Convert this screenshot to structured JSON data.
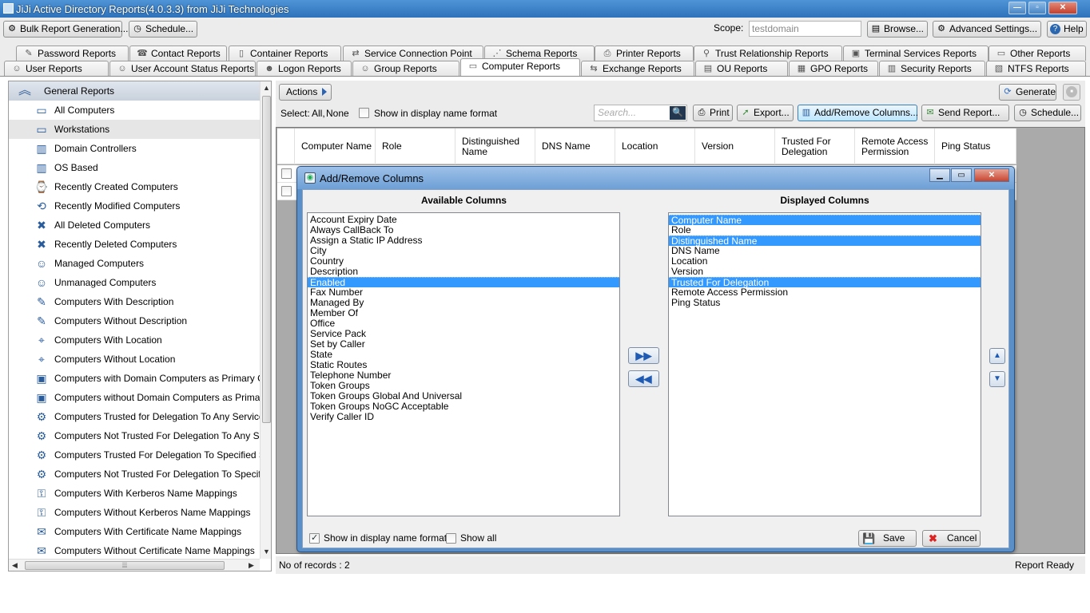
{
  "app": {
    "title": "JiJi Active Directory Reports(4.0.3.3) from JiJi Technologies"
  },
  "toolbar": {
    "bulk_label": "Bulk Report Generation...",
    "schedule_label": "Schedule...",
    "scope_label": "Scope:",
    "scope_value": "testdomain",
    "browse_label": "Browse...",
    "advanced_label": "Advanced  Settings...",
    "help_label": "Help"
  },
  "tabs_row1": [
    "Password Reports",
    "Contact Reports",
    "Container Reports",
    "Service Connection Point",
    "Schema Reports",
    "Printer Reports",
    "Trust Relationship Reports",
    "Terminal Services Reports",
    "Other Reports"
  ],
  "tabs_row2": [
    "User Reports",
    "User Account Status Reports",
    "Logon Reports",
    "Group Reports",
    "Computer Reports",
    "Exchange Reports",
    "OU Reports",
    "GPO Reports",
    "Security Reports",
    "NTFS Reports"
  ],
  "sidebar": {
    "header": "General Reports",
    "items": [
      "All Computers",
      "Workstations",
      "Domain Controllers",
      "OS Based",
      "Recently Created Computers",
      "Recently Modified Computers",
      "All Deleted Computers",
      "Recently Deleted Computers",
      "Managed Computers",
      "Unmanaged Computers",
      "Computers With Description",
      "Computers Without Description",
      "Computers With Location",
      "Computers Without Location",
      "Computers with Domain Computers as Primary Group",
      "Computers without Domain Computers as Primary Group",
      "Computers Trusted for Delegation To Any Service",
      "Computers Not Trusted For Delegation To Any Service",
      "Computers Trusted For Delegation To Specified Services",
      "Computers Not Trusted For Delegation To Specified Services",
      "Computers With Kerberos Name Mappings",
      "Computers Without Kerberos Name Mappings",
      "Computers With Certificate Name Mappings",
      "Computers Without Certificate Name Mappings"
    ],
    "selected_index": 1
  },
  "report": {
    "actions_label": "Actions",
    "select_label": "Select:",
    "select_all": "All,",
    "select_none": "None",
    "display_name_label": "Show in display name format",
    "search_placeholder": "Search...",
    "generate_label": "Generate",
    "print_label": "Print",
    "export_label": "Export...",
    "addremove_label": "Add/Remove Columns...",
    "send_label": "Send Report...",
    "schedule_label": "Schedule...",
    "columns": [
      "Computer Name",
      "Role",
      "Distinguished Name",
      "DNS Name",
      "Location",
      "Version",
      "Trusted For Delegation",
      "Remote Access Permission",
      "Ping Status"
    ],
    "records_label": "No of records : 2",
    "status": "Report Ready"
  },
  "dialog": {
    "title": "Add/Remove Columns",
    "available_header": "Available Columns",
    "displayed_header": "Displayed Columns",
    "available": [
      "Account Expiry Date",
      "Always CallBack To",
      "Assign a Static IP Address",
      "City",
      "Country",
      "Description",
      "Enabled",
      "Fax Number",
      "Managed By",
      "Member Of",
      "Office",
      "Service Pack",
      "Set by Caller",
      "State",
      "Static Routes",
      "Telephone Number",
      "Token Groups",
      "Token Groups Global And Universal",
      "Token Groups NoGC Acceptable",
      "Verify Caller ID"
    ],
    "available_selected": [
      6
    ],
    "displayed": [
      "Computer Name",
      "Role",
      "Distinguished Name",
      "DNS Name",
      "Location",
      "Version",
      "Trusted For Delegation",
      "Remote Access Permission",
      "Ping Status"
    ],
    "displayed_selected": [
      0,
      2,
      6
    ],
    "show_display_name_label": "Show in display name format",
    "show_display_name_checked": true,
    "show_all_label": "Show all",
    "show_all_checked": false,
    "save_label": "Save",
    "cancel_label": "Cancel"
  },
  "colors": {
    "accent": "#3399ff",
    "titlebar": "#3d82c8",
    "grid_bg": "#aaaaaa"
  }
}
